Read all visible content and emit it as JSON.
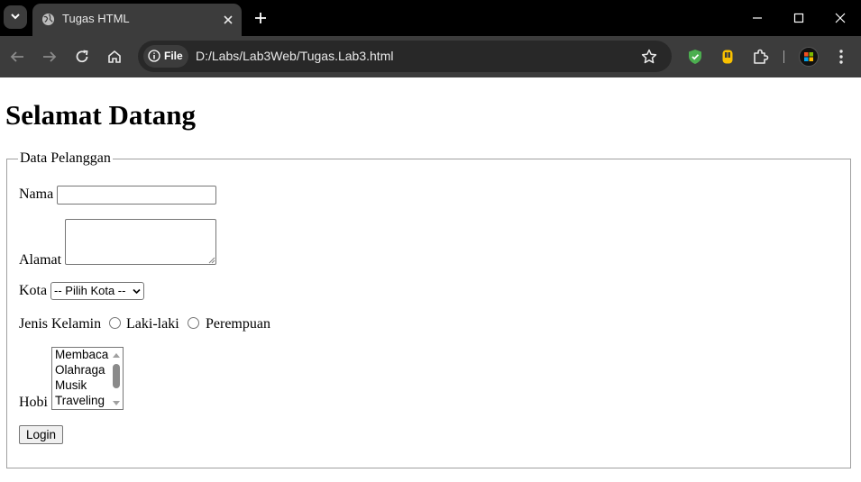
{
  "browser": {
    "tab": {
      "title": "Tugas HTML"
    },
    "address_bar": {
      "scheme_label": "File",
      "url": "D:/Labs/Lab3Web/Tugas.Lab3.html"
    },
    "colors": {
      "frame": "#000000",
      "toolbar": "#3c3c3c",
      "omnibox": "#282828",
      "shield": "#4caf50",
      "ext_yellow": "#f9c100"
    }
  },
  "page": {
    "heading": "Selamat Datang",
    "form": {
      "legend": "Data Pelanggan",
      "nama_label": "Nama",
      "nama_value": "",
      "alamat_label": "Alamat",
      "alamat_value": "",
      "kota_label": "Kota",
      "kota_selected": "-- Pilih Kota --",
      "gender_label": "Jenis Kelamin",
      "gender_options": [
        "Laki-laki",
        "Perempuan"
      ],
      "hobi_label": "Hobi",
      "hobi_options": [
        "Membaca",
        "Olahraga",
        "Musik",
        "Traveling"
      ],
      "submit_label": "Login"
    }
  }
}
